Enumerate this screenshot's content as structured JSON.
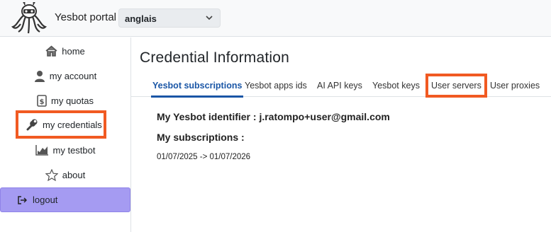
{
  "header": {
    "brand": "Yesbot portal",
    "language": "anglais"
  },
  "sidebar": {
    "items": [
      {
        "label": "home",
        "icon": "home-icon"
      },
      {
        "label": "my account",
        "icon": "user-icon"
      },
      {
        "label": "my quotas",
        "icon": "quota-icon"
      },
      {
        "label": "my credentials",
        "icon": "wrench-icon"
      },
      {
        "label": "my testbot",
        "icon": "chart-icon"
      },
      {
        "label": "about",
        "icon": "star-icon"
      }
    ],
    "logout": "logout"
  },
  "main": {
    "title": "Credential Information",
    "tabs": [
      {
        "label": "Yesbot subscriptions"
      },
      {
        "label": "Yesbot apps ids"
      },
      {
        "label": "AI API keys"
      },
      {
        "label": "Yesbot keys"
      },
      {
        "label": "User servers"
      },
      {
        "label": "User proxies"
      }
    ],
    "identifier_label": "My Yesbot identifier :",
    "identifier_value": "j.ratompo+user@gmail.com",
    "subscriptions_label": "My subscriptions :",
    "subscriptions": [
      "01/07/2025 -> 01/07/2026"
    ]
  },
  "colors": {
    "accent": "#1a56a6",
    "highlight_border": "#f15a22",
    "logout_bg": "#a59bf2"
  }
}
